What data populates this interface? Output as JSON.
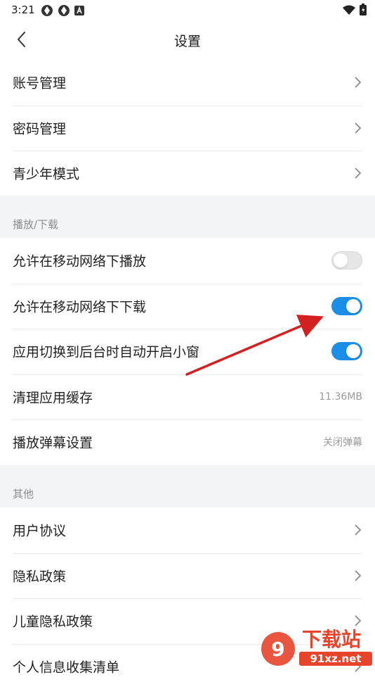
{
  "status_bar": {
    "time": "3:21",
    "left_icons": [
      "app-notification-icon",
      "app-notification-icon",
      "font-a-icon"
    ],
    "right_icons": [
      "wifi-icon",
      "battery-icon"
    ]
  },
  "nav": {
    "title": "设置",
    "back_icon": "chevron-left-icon"
  },
  "account_section": {
    "items": [
      {
        "label": "账号管理"
      },
      {
        "label": "密码管理"
      },
      {
        "label": "青少年模式"
      }
    ]
  },
  "playback_section": {
    "header": "播放/下载",
    "items": [
      {
        "label": "允许在移动网络下播放",
        "toggle": false
      },
      {
        "label": "允许在移动网络下下载",
        "toggle": true
      },
      {
        "label": "应用切换到后台时自动开启小窗",
        "toggle": true
      },
      {
        "label": "清理应用缓存",
        "value": "11.36MB"
      },
      {
        "label": "播放弹幕设置",
        "value": "关闭弹幕"
      }
    ]
  },
  "other_section": {
    "header": "其他",
    "items": [
      {
        "label": "用户协议"
      },
      {
        "label": "隐私政策"
      },
      {
        "label": "儿童隐私政策"
      },
      {
        "label": "个人信息收集清单"
      }
    ]
  },
  "watermark": {
    "logo_text": "下载站",
    "url_text": "91xz.net"
  },
  "colors": {
    "accent": "#1b8fe8",
    "toggle_off": "#e6e6e6",
    "section_bg": "#f3f4f6",
    "annotation_arrow": "#d42020"
  }
}
